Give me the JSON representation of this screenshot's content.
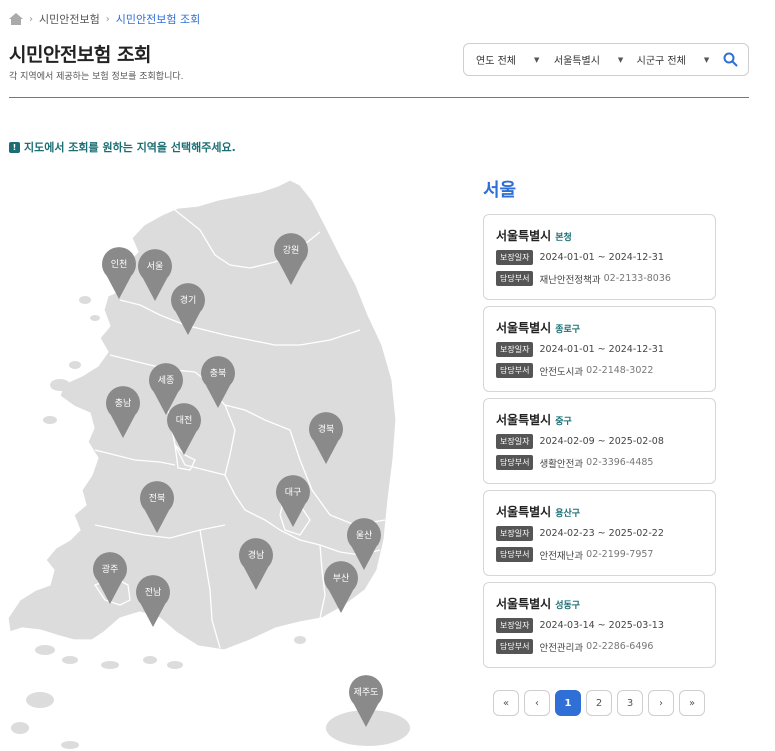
{
  "breadcrumb": {
    "item1": "시민안전보험",
    "item2": "시민안전보험 조회"
  },
  "header": {
    "title": "시민안전보험 조회",
    "subtitle": "각 지역에서 제공하는 보험 정보를 조회합니다."
  },
  "filters": {
    "year": "연도 전체",
    "city": "서울특별시",
    "district": "시군구 전체"
  },
  "notice": "지도에서 조회를 원하는 지역을 선택해주세요.",
  "map": {
    "markers": [
      "인천",
      "서울",
      "강원",
      "경기",
      "충남",
      "세종",
      "충북",
      "대전",
      "경북",
      "전북",
      "대구",
      "울산",
      "광주",
      "경남",
      "전남",
      "부산",
      "제주도"
    ]
  },
  "region_title": "서울",
  "labels": {
    "coverage": "보장일자",
    "department": "담당부서"
  },
  "cards": [
    {
      "city": "서울특별시",
      "district": "본청",
      "period": "2024-01-01 ~ 2024-12-31",
      "dept": "재난안전정책과",
      "phone": "02-2133-8036"
    },
    {
      "city": "서울특별시",
      "district": "종로구",
      "period": "2024-01-01 ~ 2024-12-31",
      "dept": "안전도시과",
      "phone": "02-2148-3022"
    },
    {
      "city": "서울특별시",
      "district": "중구",
      "period": "2024-02-09 ~ 2025-02-08",
      "dept": "생활안전과",
      "phone": "02-3396-4485"
    },
    {
      "city": "서울특별시",
      "district": "용산구",
      "period": "2024-02-23 ~ 2025-02-22",
      "dept": "안전재난과",
      "phone": "02-2199-7957"
    },
    {
      "city": "서울특별시",
      "district": "성동구",
      "period": "2024-03-14 ~ 2025-03-13",
      "dept": "안전관리과",
      "phone": "02-2286-6496"
    }
  ],
  "pagination": {
    "first": "«",
    "prev": "‹",
    "pages": [
      "1",
      "2",
      "3"
    ],
    "active": "1",
    "next": "›",
    "last": "»"
  },
  "colors": {
    "accent": "#2f6fd6",
    "teal": "#1b6f73",
    "map_land": "#dcdcdc",
    "marker": "#8a8a8a"
  }
}
